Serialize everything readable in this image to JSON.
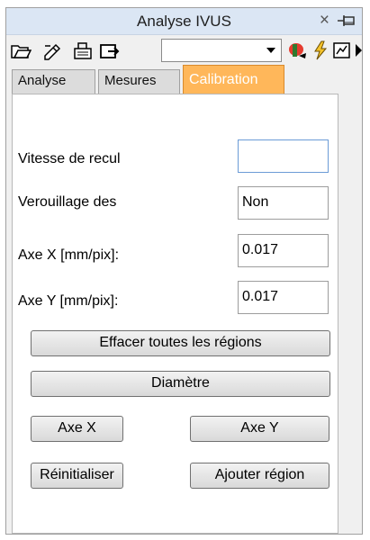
{
  "window": {
    "title": "Analyse IVUS",
    "close_symbol": "×"
  },
  "toolbar": {
    "combo_value": "",
    "icons": [
      "open-folder-icon",
      "edit-image-icon",
      "export-icon",
      "import-icon",
      "color-tool-icon",
      "flash-icon",
      "chart-icon",
      "more-icon"
    ]
  },
  "tabs": [
    {
      "label": "Analyse",
      "active": false
    },
    {
      "label": "Mesures",
      "active": false
    },
    {
      "label": "Calibration",
      "active": true
    }
  ],
  "form": {
    "vitesse_label": "Vitesse de recul",
    "vitesse_value": "",
    "verrouillage_label": "Verouillage des",
    "verrouillage_value": "Non",
    "axe_x_label": "Axe X [mm/pix]:",
    "axe_x_value": "0.017",
    "axe_y_label": "Axe Y [mm/pix]:",
    "axe_y_value": "0.017"
  },
  "buttons": {
    "effacer": "Effacer toutes les régions",
    "diametre": "Diamètre",
    "axe_x": "Axe X",
    "axe_y": "Axe Y",
    "reinitialiser": "Réinitialiser",
    "ajouter": "Ajouter région"
  },
  "colors": {
    "active_tab": "#ffb75a",
    "titlebar": "#dbe6f4"
  }
}
